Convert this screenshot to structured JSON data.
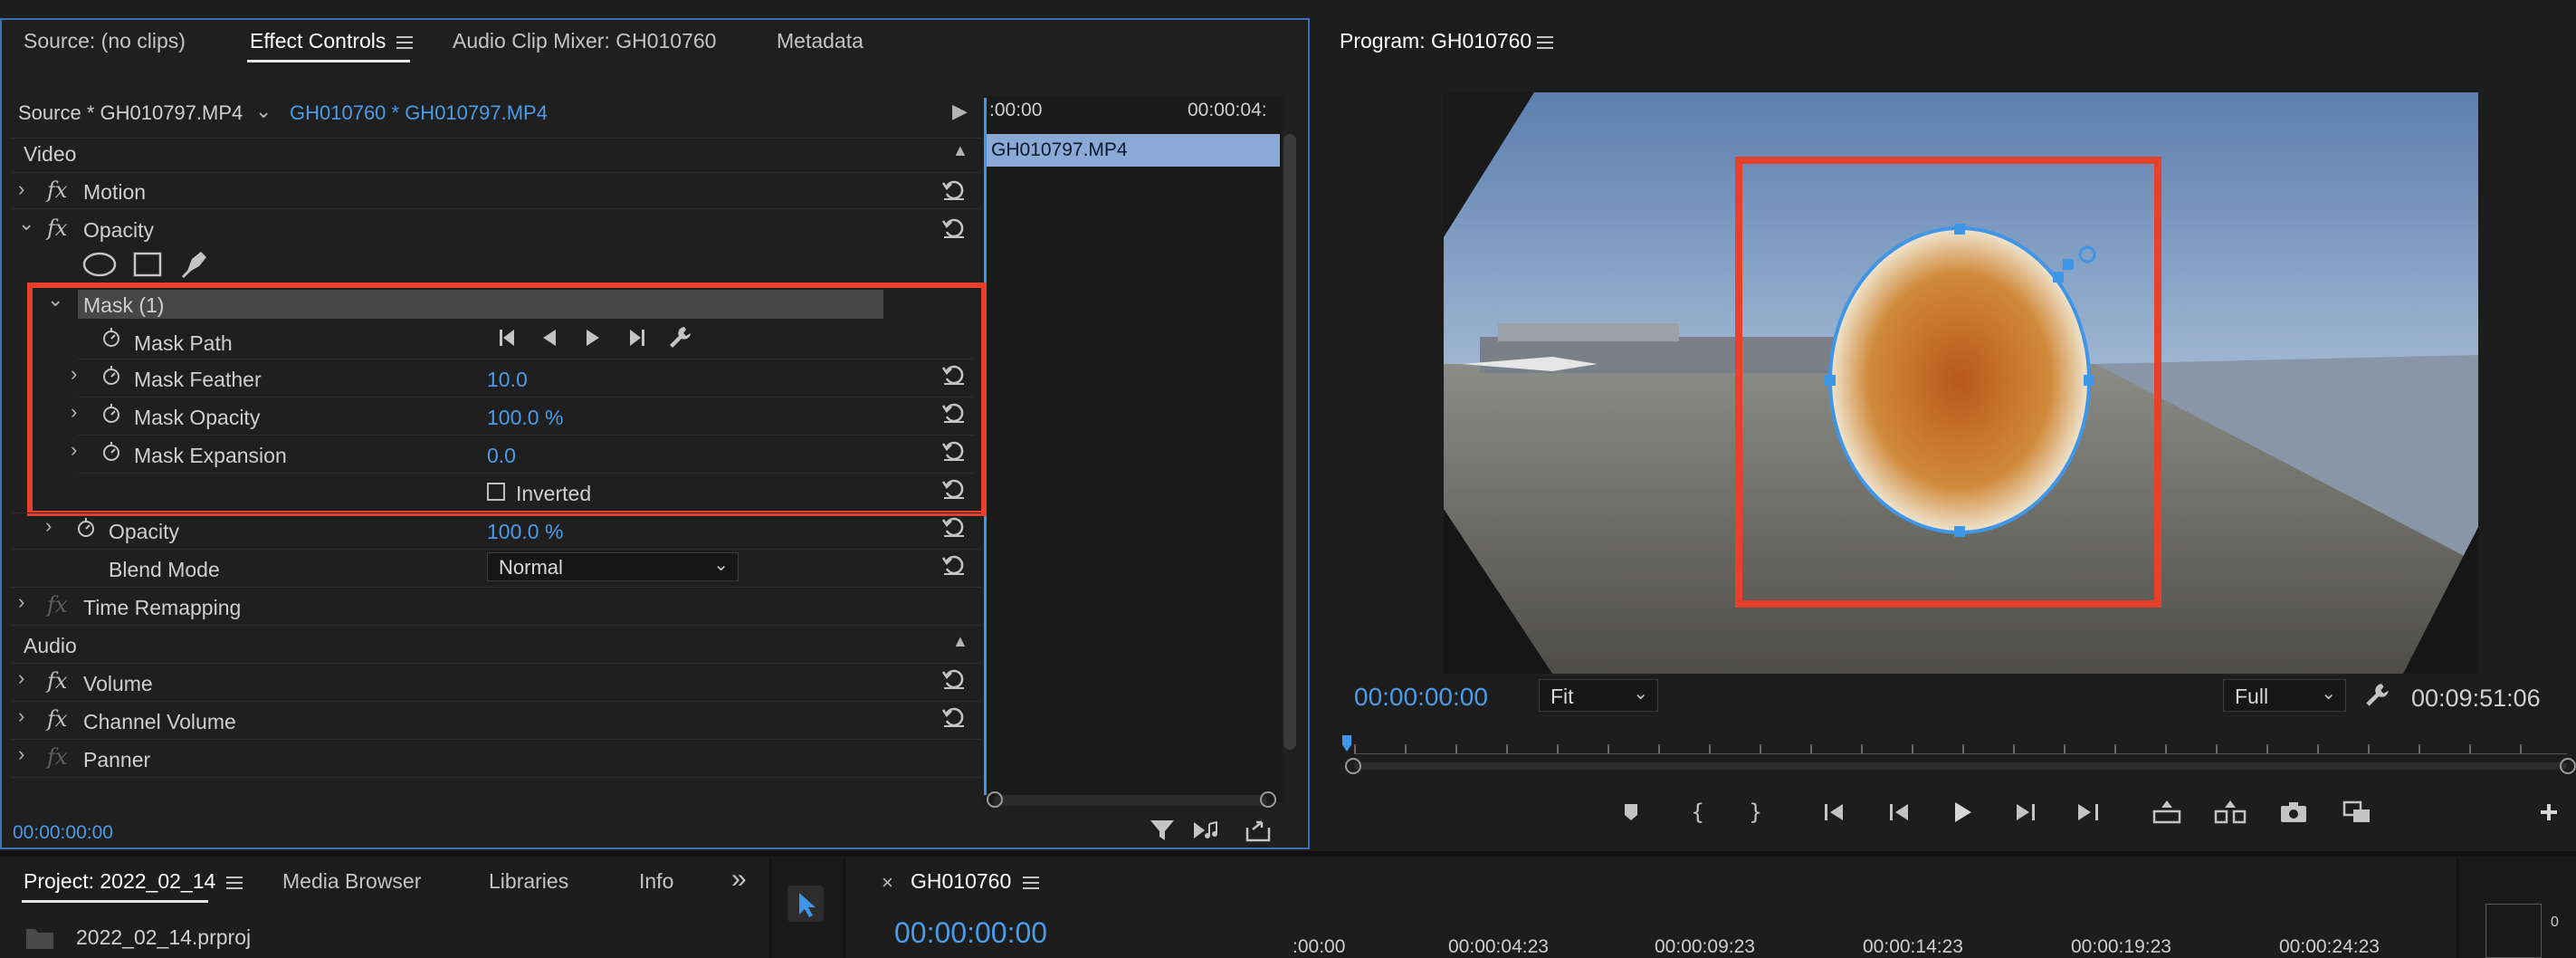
{
  "top_panel": {
    "tabs": [
      {
        "label": "Source: (no clips)"
      },
      {
        "label": "Effect Controls"
      },
      {
        "label": "Audio Clip Mixer: GH010760"
      },
      {
        "label": "Metadata"
      }
    ]
  },
  "effect_controls": {
    "source_label": "Source * GH010797.MP4",
    "sequence_clip": "GH010760 * GH010797.MP4",
    "timeline_start": ":00:00",
    "timeline_end": "00:00:04:",
    "clip_bar_label": "GH010797.MP4",
    "video_header": "Video",
    "audio_header": "Audio",
    "motion_label": "Motion",
    "opacity_group_label": "Opacity",
    "mask_label": "Mask (1)",
    "mask_path_label": "Mask Path",
    "mask_feather_label": "Mask Feather",
    "mask_feather_value": "10.0",
    "mask_opacity_label": "Mask Opacity",
    "mask_opacity_value": "100.0 %",
    "mask_expansion_label": "Mask Expansion",
    "mask_expansion_value": "0.0",
    "inverted_label": "Inverted",
    "opacity_label": "Opacity",
    "opacity_value": "100.0 %",
    "blend_mode_label": "Blend Mode",
    "blend_mode_value": "Normal",
    "time_remapping_label": "Time Remapping",
    "volume_label": "Volume",
    "channel_volume_label": "Channel Volume",
    "panner_label": "Panner",
    "current_time": "00:00:00:00"
  },
  "program_monitor": {
    "title": "Program: GH010760",
    "timecode": "00:00:00:00",
    "fit_value": "Fit",
    "quality_value": "Full",
    "duration": "00:09:51:06"
  },
  "bottom_panel": {
    "project_tab": "Project: 2022_02_14",
    "media_browser_tab": "Media Browser",
    "libraries_tab": "Libraries",
    "info_tab": "Info",
    "more_glyph": "»",
    "project_item": "2022_02_14.prproj",
    "sequence_close": "×",
    "sequence_tab": "GH010760",
    "sequence_timecode": "00:00:00:00",
    "ruler_labels": [
      ":00:00",
      "00:00:04:23",
      "00:00:09:23",
      "00:00:14:23",
      "00:00:19:23",
      "00:00:24:23"
    ],
    "corner_value": "0"
  },
  "colors": {
    "accent_blue": "#3f95e6",
    "highlight_red": "#e8402a",
    "panel_bg": "#1d1d1d"
  }
}
